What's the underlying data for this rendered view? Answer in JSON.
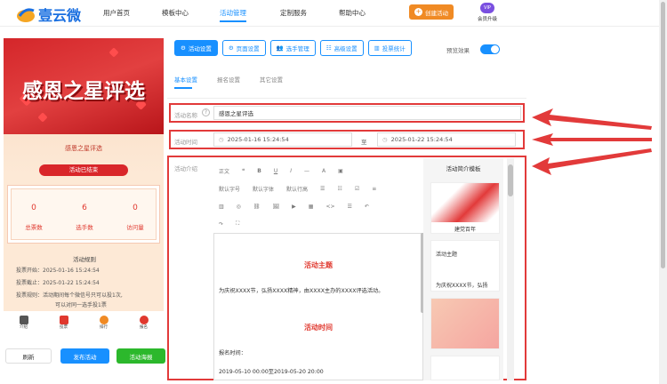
{
  "header": {
    "logo_text": "壹云微",
    "nav": [
      "用户首页",
      "模板中心",
      "活动管理",
      "定制服务",
      "帮助中心"
    ],
    "create_label": "创建活动",
    "vip_badge": "VIP",
    "vip_label": "会员升级"
  },
  "preview": {
    "banner_title": "感恩之星评选",
    "card_title": "感恩之星评选",
    "status": "活动已结束",
    "stats": [
      {
        "value": "0",
        "label": "总票数"
      },
      {
        "value": "6",
        "label": "选手数"
      },
      {
        "value": "0",
        "label": "访问量"
      }
    ],
    "rules_title": "活动规则",
    "rules": [
      "投票开始：2025-01-16 15:24:54",
      "投票截止：2025-01-22 15:24:54",
      "投票规则：活动期间每个微信号只可以投1次,",
      "可以对同一选手投1票"
    ],
    "bottom_nav": [
      "介绍",
      "投票",
      "排行",
      "报名"
    ],
    "buttons": {
      "refresh": "刷新",
      "publish": "发布活动",
      "qr": "活动海报"
    }
  },
  "editor": {
    "tabs": [
      "活动设置",
      "页面设置",
      "选手管理",
      "高级设置",
      "投票统计"
    ],
    "preview_effect": "预览效果",
    "subtabs": [
      "基本设置",
      "报名设置",
      "其它设置"
    ],
    "name_label": "活动名称",
    "name_value": "感恩之星评选",
    "time_label": "活动时间",
    "start_time": "2025-01-16 15:24:54",
    "to_label": "至",
    "end_time": "2025-01-22 15:24:54",
    "intro_label": "活动介绍",
    "toolbar_row1": [
      "正文",
      "❝",
      "B",
      "U",
      "I",
      "—",
      "A",
      "▣"
    ],
    "toolbar_row2": [
      "默认字号",
      "默认字体",
      "默认行高",
      "☰",
      "☷",
      "☑",
      "≡"
    ],
    "toolbar_row3": [
      "▥",
      "◎",
      "⛓",
      "🖼",
      "▶",
      "▦",
      "<>",
      "☰",
      "↶"
    ],
    "toolbar_row4": [
      "↷",
      "⛶"
    ],
    "content": {
      "h1": "活动主题",
      "p1": "为庆祝XXXX节，弘扬XXXX精神，由XXXX主办的XXXX评选活动。",
      "h2": "活动时间",
      "p2": "报名时间：",
      "p3": "2019-05-10 00:00至2019-05-20 20:00"
    },
    "template_title": "活动简介模板",
    "template_items": [
      "建党百年",
      "活动主题",
      "为庆祝XXXX节，弘扬"
    ]
  },
  "colors": {
    "accent": "#1890ff",
    "alert": "#e23a3a",
    "brand_red": "#d4262a",
    "orange": "#f08a24"
  }
}
